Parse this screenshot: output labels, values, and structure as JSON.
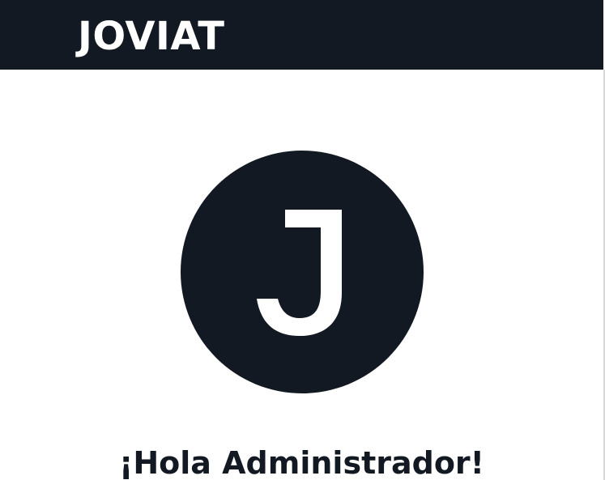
{
  "header": {
    "brand_name": "JOVIAT"
  },
  "profile": {
    "avatar_initial": "J",
    "greeting": "¡Hola Administrador!"
  },
  "colors": {
    "dark": "#131922",
    "light": "#ffffff"
  }
}
